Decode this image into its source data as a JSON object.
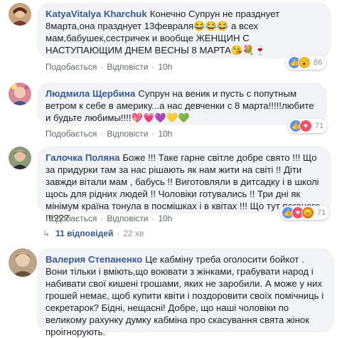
{
  "comments": [
    {
      "author": "KatyaVitalya Kharchuk",
      "text": "Конечно Супрун не празднует 8марта,она празднует 13февраля😂😂😂 а всех мам,бабушек,сестричек и вообще ЖЕНЩИН С НАСТУПАЮЩИМ ДНЕМ ВЕСНЫ 8 МАРТА😘💐🍷",
      "like": "Подобається",
      "reply": "Відповісти",
      "time": "10h",
      "reaction_count": "86",
      "reactions": [
        "like",
        "wow"
      ]
    },
    {
      "author": "Людмила Щербина",
      "text": "Супрун на веник и пусть с попутным ветром к себе в америку...а нас девченки с 8 марта!!!!!любите и будьте любимы!!!!💖💗💜💛💚",
      "like": "Подобається",
      "reply": "Відповісти",
      "time": "10h",
      "reaction_count": "71",
      "reactions": [
        "like",
        "love"
      ]
    },
    {
      "author": "Галочка Поляна",
      "text": "Боже !!! Таке гарне світле добре свято !!! Що за придурки там за нас рішають як нам жити на світі !! Діти завжди вітали мам , бабусь !! Виготовляли в дитсадку і в школі щось для рідних людей !! Чоловіки готувались !! Три дні як мінімум країна тонула в посмішках і в квітах !!! Що тут поганого !!!???",
      "like": "Подобається",
      "reply": "Відповісти",
      "time": "10h",
      "reaction_count": "71",
      "reactions": [
        "like",
        "love",
        "angry"
      ]
    },
    {
      "author": "Валерия Степаненко",
      "text": "Це кабміну треба оголосити бойкот . Вони тільки і вміють,що воювати з жінками, грабувати народ і набивати свої кишені грошами, яких не заробили. А може у них грошей немає, щоб купити квіти і поздоровити своїх помічниць і секретарок? Бідні, нещасні! Добре, що наші чоловіки по великому рахунку думку кабміна про скасування свята жінок проігнорують."
    }
  ],
  "replies_thread": {
    "label": "11 відповідей",
    "time": "22 хв"
  },
  "colors": {
    "link": "#385898",
    "bubble": "#f2f3f5",
    "meta": "#606770"
  }
}
